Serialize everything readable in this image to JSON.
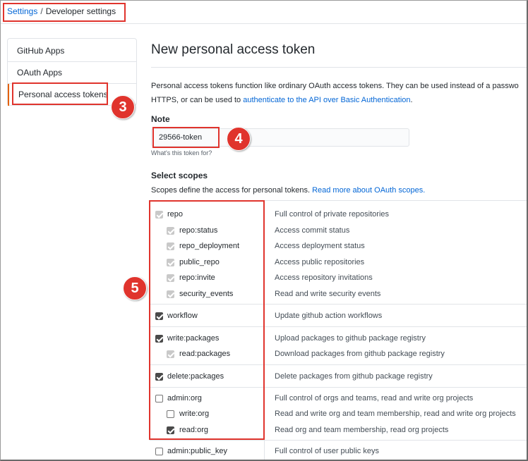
{
  "breadcrumb": {
    "root": "Settings",
    "separator": "/",
    "current": "Developer settings"
  },
  "sidebar": {
    "items": [
      {
        "label": "GitHub Apps"
      },
      {
        "label": "OAuth Apps"
      },
      {
        "label": "Personal access tokens"
      }
    ]
  },
  "annotations": {
    "step3": "3",
    "step4": "4",
    "step5": "5"
  },
  "page": {
    "title": "New personal access token",
    "intro_line1": "Personal access tokens function like ordinary OAuth access tokens. They can be used instead of a passwo",
    "intro_line2_prefix": "HTTPS, or can be used to ",
    "intro_link": "authenticate to the API over Basic Authentication",
    "intro_line2_suffix": "."
  },
  "note": {
    "label": "Note",
    "value": "29566-token",
    "hint": "What's this token for?"
  },
  "scopes": {
    "title": "Select scopes",
    "desc_prefix": "Scopes define the access for personal tokens. ",
    "desc_link": "Read more about OAuth scopes.",
    "rows": [
      {
        "name": "repo",
        "desc": "Full control of private repositories",
        "level": "parent",
        "state": "disabled"
      },
      {
        "name": "repo:status",
        "desc": "Access commit status",
        "level": "child",
        "state": "disabled"
      },
      {
        "name": "repo_deployment",
        "desc": "Access deployment status",
        "level": "child",
        "state": "disabled"
      },
      {
        "name": "public_repo",
        "desc": "Access public repositories",
        "level": "child",
        "state": "disabled"
      },
      {
        "name": "repo:invite",
        "desc": "Access repository invitations",
        "level": "child",
        "state": "disabled"
      },
      {
        "name": "security_events",
        "desc": "Read and write security events",
        "level": "child",
        "state": "disabled"
      },
      {
        "name": "workflow",
        "desc": "Update github action workflows",
        "level": "parent",
        "state": "checked"
      },
      {
        "name": "write:packages",
        "desc": "Upload packages to github package registry",
        "level": "parent",
        "state": "checked"
      },
      {
        "name": "read:packages",
        "desc": "Download packages from github package registry",
        "level": "child",
        "state": "disabled"
      },
      {
        "name": "delete:packages",
        "desc": "Delete packages from github package registry",
        "level": "parent",
        "state": "checked"
      },
      {
        "name": "admin:org",
        "desc": "Full control of orgs and teams, read and write org projects",
        "level": "parent",
        "state": "unchecked"
      },
      {
        "name": "write:org",
        "desc": "Read and write org and team membership, read and write org projects",
        "level": "child",
        "state": "unchecked"
      },
      {
        "name": "read:org",
        "desc": "Read org and team membership, read org projects",
        "level": "child",
        "state": "checked"
      },
      {
        "name": "admin:public_key",
        "desc": "Full control of user public keys",
        "level": "parent",
        "state": "unchecked"
      }
    ]
  },
  "colors": {
    "link": "#0366d6",
    "annotation": "#e0342d",
    "sidebar_active": "#e36209"
  }
}
